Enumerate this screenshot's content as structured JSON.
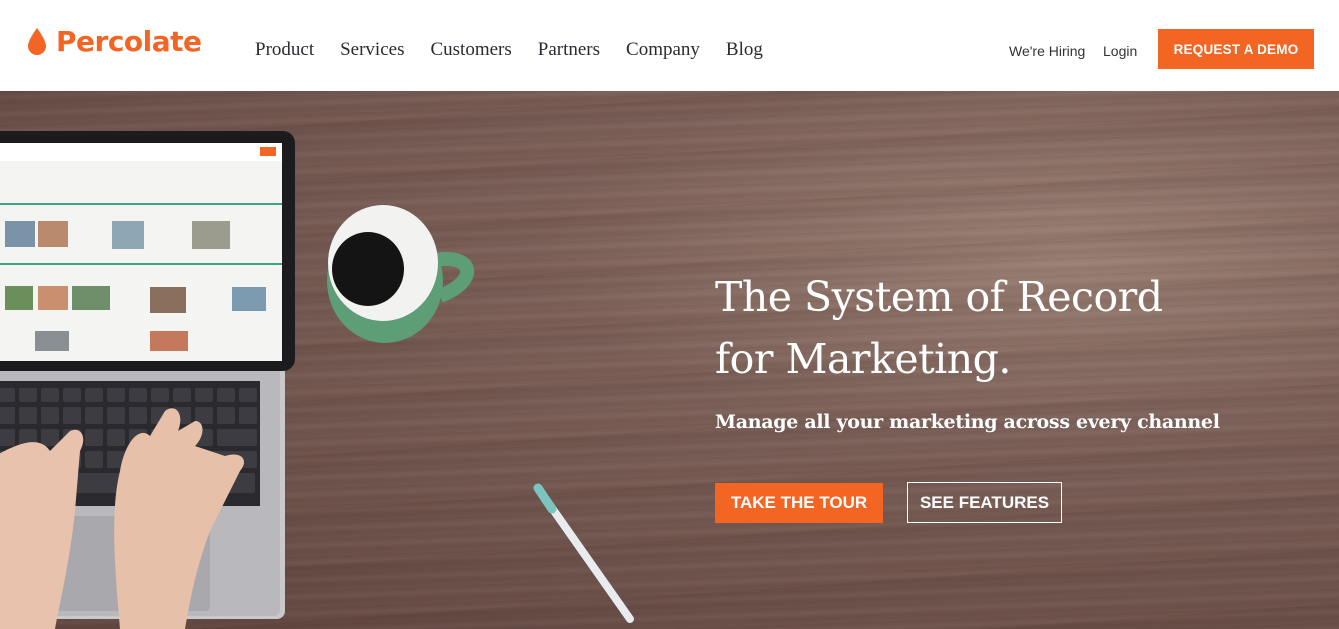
{
  "brand": {
    "name": "Percolate",
    "accent": "#f26522"
  },
  "nav": {
    "items": [
      "Product",
      "Services",
      "Customers",
      "Partners",
      "Company",
      "Blog"
    ]
  },
  "utility": {
    "hiring": "We're Hiring",
    "login": "Login"
  },
  "cta": {
    "demo": "REQUEST A DEMO"
  },
  "hero": {
    "headline_line1": "The System of Record",
    "headline_line2": "for Marketing.",
    "subhead": "Manage all your marketing across every channel",
    "primary_button": "TAKE THE TOUR",
    "secondary_button": "SEE FEATURES"
  }
}
